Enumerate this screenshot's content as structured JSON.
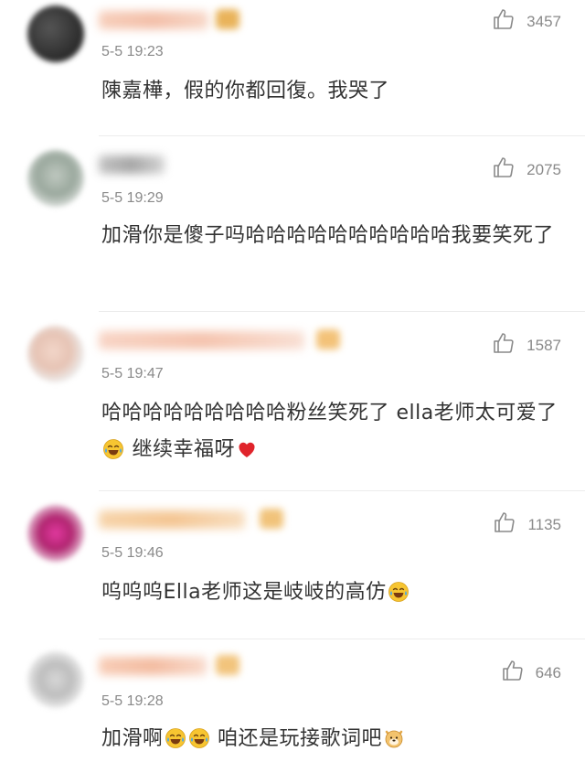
{
  "comments": [
    {
      "time": "5-5 19:23",
      "likes": "3457",
      "segments": [
        {
          "t": "陳嘉樺，假的你都回復。我哭了"
        }
      ]
    },
    {
      "time": "5-5 19:29",
      "likes": "2075",
      "segments": [
        {
          "t": "加滑你是傻子吗哈哈哈哈哈哈哈哈哈哈我要笑死了"
        }
      ]
    },
    {
      "time": "5-5 19:47",
      "likes": "1587",
      "segments": [
        {
          "t": "哈哈哈哈哈哈哈哈哈粉丝笑死了 ella老师太可爱了"
        },
        {
          "emoji": "laugh-cry-emoji"
        },
        {
          "t": " 继续幸福呀"
        },
        {
          "emoji": "red-heart-emoji"
        }
      ]
    },
    {
      "time": "5-5 19:46",
      "likes": "1135",
      "segments": [
        {
          "t": "呜呜呜Ella老师这是岐岐的高仿"
        },
        {
          "emoji": "laugh-cry-emoji"
        }
      ]
    },
    {
      "time": "5-5 19:28",
      "likes": "646",
      "segments": [
        {
          "t": "加滑啊"
        },
        {
          "emoji": "laugh-cry-emoji"
        },
        {
          "emoji": "laugh-cry-emoji"
        },
        {
          "t": "  咱还是玩接歌词吧"
        },
        {
          "emoji": "doge-emoji"
        }
      ]
    }
  ],
  "icons": {
    "like": "thumbs-up-icon"
  },
  "colors": {
    "text": "#333333",
    "meta": "#8a8a8a",
    "heart": "#e0242b",
    "emoji_face": "#f7c531"
  }
}
